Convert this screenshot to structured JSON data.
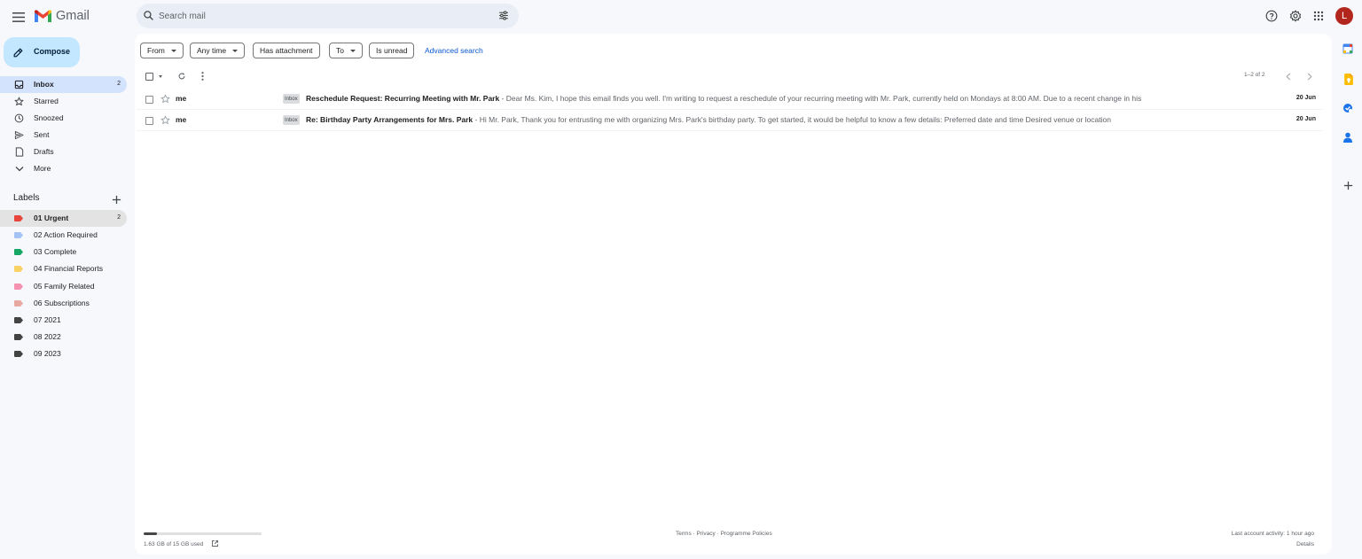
{
  "app": {
    "logo_text": "Gmail"
  },
  "search": {
    "placeholder": "Search mail"
  },
  "user": {
    "avatar_letter": "L"
  },
  "compose": {
    "label": "Compose"
  },
  "nav": [
    {
      "label": "Inbox",
      "count": "2",
      "icon": "inbox-icon"
    },
    {
      "label": "Starred",
      "icon": "star-icon"
    },
    {
      "label": "Snoozed",
      "icon": "clock-icon"
    },
    {
      "label": "Sent",
      "icon": "send-icon"
    },
    {
      "label": "Drafts",
      "icon": "draft-icon"
    },
    {
      "label": "More",
      "icon": "chevron-down-icon"
    }
  ],
  "labels": {
    "heading": "Labels",
    "items": [
      {
        "label": "01 Urgent",
        "count": "2",
        "color": "#e8453c"
      },
      {
        "label": "02 Action Required",
        "color": "#a4c2f4"
      },
      {
        "label": "03 Complete",
        "color": "#16a765"
      },
      {
        "label": "04 Financial Reports",
        "color": "#fad165"
      },
      {
        "label": "05 Family Related",
        "color": "#f691b2"
      },
      {
        "label": "06 Subscriptions",
        "color": "#e7a9a2"
      },
      {
        "label": "07 2021",
        "color": "#434343"
      },
      {
        "label": "08 2022",
        "color": "#434343"
      },
      {
        "label": "09 2023",
        "color": "#434343"
      }
    ]
  },
  "filters": {
    "from": "From",
    "any_time": "Any time",
    "has_attachment": "Has attachment",
    "to": "To",
    "is_unread": "Is unread",
    "advanced_search": "Advanced search"
  },
  "pager": {
    "text": "1–2 of 2"
  },
  "emails": [
    {
      "sender": "me",
      "badge": "Inbox",
      "subject": "Reschedule Request: Recurring Meeting with Mr. Park",
      "snippet": "Dear Ms. Kim, I hope this email finds you well. I'm writing to request a reschedule of your recurring meeting with Mr. Park, currently held on Mondays at 8:00 AM. Due to a recent change in his",
      "date": "20 Jun"
    },
    {
      "sender": "me",
      "badge": "Inbox",
      "subject": "Re: Birthday Party Arrangements for Mrs. Park",
      "snippet": "Hi Mr. Park, Thank you for entrusting me with organizing Mrs. Park's birthday party. To get started, it would be helpful to know a few details: Preferred date and time Desired venue or location",
      "date": "20 Jun"
    }
  ],
  "footer": {
    "storage": "1.63 GB of 15 GB used",
    "storage_fraction": 0.11,
    "terms": "Terms",
    "privacy": "Privacy",
    "policies": "Programme Policies",
    "dot": " · ",
    "activity": "Last account activity: 1 hour ago",
    "details": "Details"
  },
  "colors": {
    "accent": "#0b57d0",
    "compose_bg": "#c2e7ff",
    "active_nav": "#d3e3fd",
    "avatar": "#b3261e"
  }
}
